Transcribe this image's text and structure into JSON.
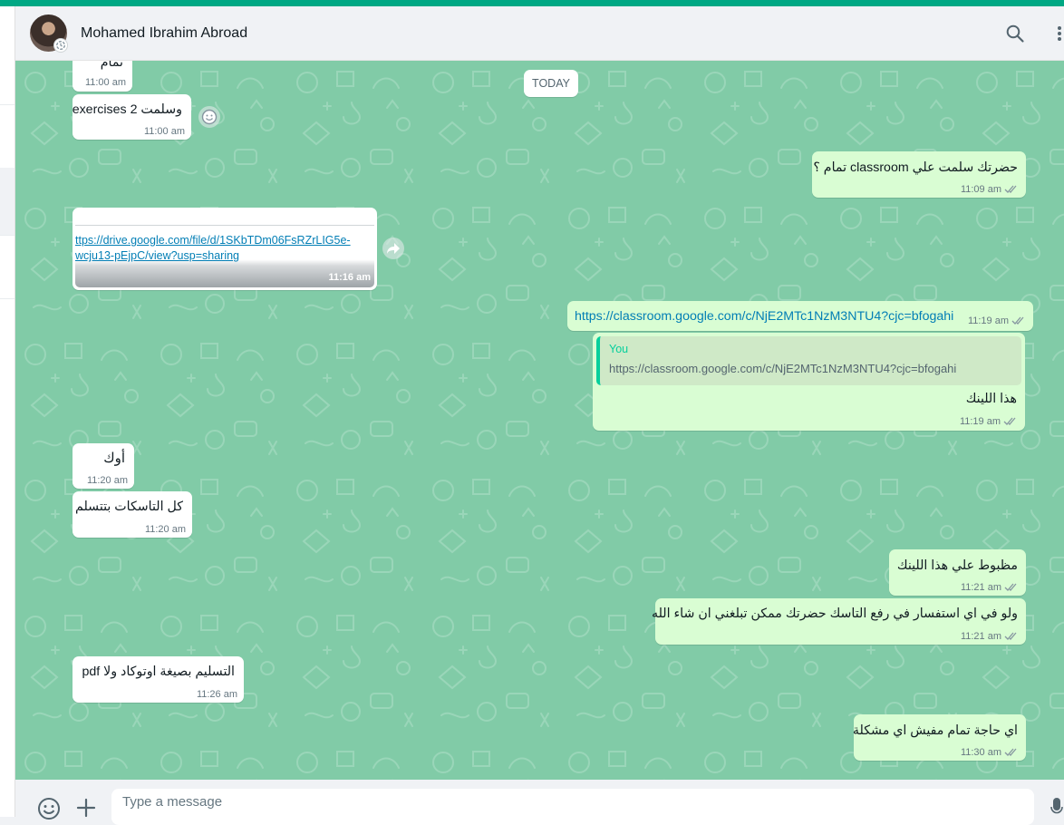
{
  "header": {
    "contact_name": "Mohamed Ibrahim Abroad"
  },
  "date_chip": "TODAY",
  "messages": [
    {
      "dir": "in",
      "text": "تمام",
      "time": "11:00 am"
    },
    {
      "dir": "in",
      "text": "وسلمت 2 exercises",
      "time": "11:00 am"
    },
    {
      "dir": "out",
      "text": "حضرتك سلمت علي classroom تمام ؟",
      "time": "11:09 am"
    },
    {
      "dir": "in",
      "line1": "ttps://drive.google.com/file/d/1SKbTDm06FsRZrLIG5e-",
      "line2": "wcju13-pEjpC/view?usp=sharing",
      "time": "11:16 am"
    },
    {
      "dir": "out",
      "text": "https://classroom.google.com/c/NjE2MTc1NzM3NTU4?cjc=bfogahi",
      "time": "11:19 am"
    },
    {
      "dir": "out",
      "quote_author": "You",
      "quote_text": "https://classroom.google.com/c/NjE2MTc1NzM3NTU4?cjc=bfogahi",
      "text": "هذا اللينك",
      "time": "11:19 am"
    },
    {
      "dir": "in",
      "text": "أوك",
      "time": "11:20 am"
    },
    {
      "dir": "in",
      "text": "كل التاسكات بتتسلم",
      "time": "11:20 am"
    },
    {
      "dir": "out",
      "text": "مظبوط علي هذا اللينك",
      "time": "11:21 am"
    },
    {
      "dir": "out",
      "text": "ولو في اي استفسار في رفع التاسك حضرتك ممكن تبلغني ان شاء الله",
      "time": "11:21 am"
    },
    {
      "dir": "in",
      "text": "التسليم بصيغة اوتوكاد ولا pdf",
      "time": "11:26 am"
    },
    {
      "dir": "out",
      "text": "اي حاجة تمام مفيش اي مشكلة",
      "time": "11:30 am"
    }
  ],
  "composer": {
    "placeholder": "Type a message"
  },
  "colors": {
    "accent": "#00a884",
    "chat_bg": "#81cba7",
    "incoming_bubble": "#ffffff",
    "outgoing_bubble": "#d9fdd3",
    "read_ticks": "#8696a0",
    "link": "#027eb5"
  },
  "icons": [
    "search-icon",
    "menu-icon",
    "emoji-icon",
    "plus-icon",
    "mic-icon",
    "forward-icon",
    "reaction-icon",
    "read-ticks-icon",
    "status-icon"
  ]
}
